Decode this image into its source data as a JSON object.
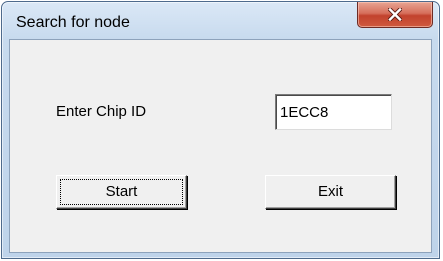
{
  "window": {
    "title": "Search for node",
    "close_icon": "close-x-icon"
  },
  "form": {
    "chip_label": "Enter Chip ID",
    "chip_value": "1ECC8"
  },
  "buttons": {
    "start_label": "Start",
    "exit_label": "Exit"
  },
  "colors": {
    "titlebar": "#c7daee",
    "client": "#f0f0f0",
    "close_button": "#c2422d"
  }
}
